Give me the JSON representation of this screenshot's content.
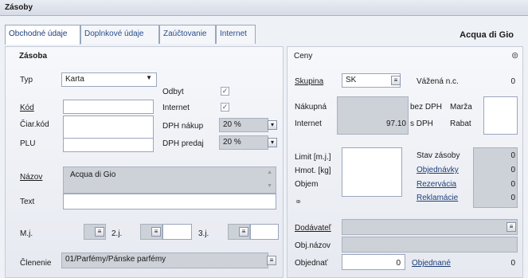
{
  "window": {
    "title": "Zásoby"
  },
  "tabs": [
    {
      "label": "Obchodné údaje"
    },
    {
      "label": "Doplnkové údaje"
    },
    {
      "label": "Zaúčtovanie"
    },
    {
      "label": "Internet"
    }
  ],
  "document_name": "Acqua di Gio",
  "zasoba": {
    "section_title": "Zásoba",
    "typ_label": "Typ",
    "typ_value": "Karta",
    "kod_label": "Kód",
    "kod_value": "",
    "ciarkod_label": "Čiar.kód",
    "ciarkod_value": "",
    "plu_label": "PLU",
    "plu_value": "",
    "odbyt_label": "Odbyt",
    "odbyt_checked": "✓",
    "internet_label": "Internet",
    "internet_checked": "✓",
    "dph_nakup_label": "DPH nákup",
    "dph_nakup_value": "20 %",
    "dph_predaj_label": "DPH predaj",
    "dph_predaj_value": "20 %",
    "nazov_label": "Názov",
    "nazov_value": "Acqua di Gio",
    "text_label": "Text",
    "text_value": "",
    "mj_label": "M.j.",
    "mj2_label": "2.j.",
    "mj3_label": "3.j.",
    "clenenie_label": "Členenie",
    "clenenie_value": "01/Parfémy/Pánske parfémy"
  },
  "ceny": {
    "section_title": "Ceny",
    "skupina_label": "Skupina",
    "skupina_value": "SK",
    "vazena_label": "Vážená n.c.",
    "vazena_value": "0",
    "nakupna_label": "Nákupná",
    "bez_dph_label": "bez DPH",
    "marza_label": "Marža",
    "internet_label": "Internet",
    "internet_value": "97.10",
    "s_dph_label": "s DPH",
    "rabat_label": "Rabat",
    "limit_label": "Limit  [m.j.]",
    "hmot_label": "Hmot. [kg]",
    "objem_label": "Objem",
    "stav_label": "Stav zásoby",
    "stav_value": "0",
    "objednavky_label": "Objednávky",
    "objednavky_value": "0",
    "rezervacia_label": "Rezervácia",
    "rezervacia_value": "0",
    "reklamacie_label": "Reklamácie",
    "reklamacie_value": "0",
    "dodavatel_label": "Dodávateľ",
    "objnazov_label": "Obj.názov",
    "objednat_label": "Objednať",
    "objednat_value": "0",
    "objednane_label": "Objednané",
    "objednane_value": "0"
  }
}
